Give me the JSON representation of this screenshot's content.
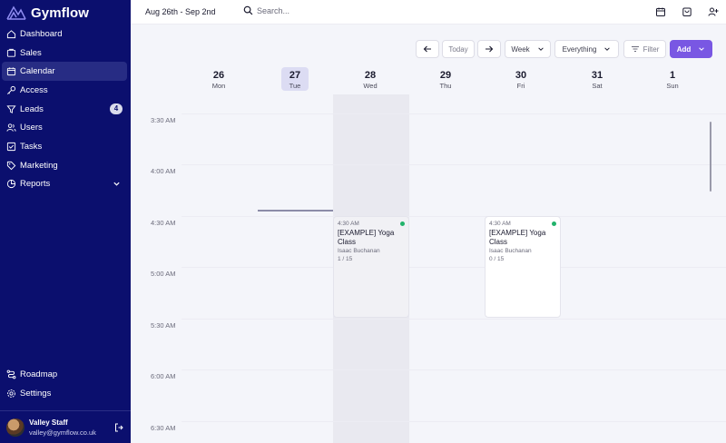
{
  "brand": {
    "name": "Gymflow"
  },
  "nav": {
    "items": [
      {
        "label": "Dashboard",
        "icon": "home-icon"
      },
      {
        "label": "Sales",
        "icon": "sales-icon"
      },
      {
        "label": "Calendar",
        "icon": "calendar-icon",
        "active": true
      },
      {
        "label": "Access",
        "icon": "key-icon"
      },
      {
        "label": "Leads",
        "icon": "filter-icon",
        "badge": "4"
      },
      {
        "label": "Users",
        "icon": "users-icon"
      },
      {
        "label": "Tasks",
        "icon": "tasks-icon"
      },
      {
        "label": "Marketing",
        "icon": "tag-icon"
      },
      {
        "label": "Reports",
        "icon": "reports-icon",
        "expandable": true
      }
    ],
    "bottom": [
      {
        "label": "Roadmap",
        "icon": "roadmap-icon"
      },
      {
        "label": "Settings",
        "icon": "gear-icon"
      }
    ]
  },
  "user": {
    "name": "Valley Staff",
    "email": "valley@gymflow.co.uk"
  },
  "topbar": {
    "date_range": "Aug 26th - Sep 2nd",
    "search_placeholder": "Search..."
  },
  "toolbar": {
    "today_label": "Today",
    "view_label": "Week",
    "scope_label": "Everything",
    "filter_label": "Filter",
    "add_label": "Add"
  },
  "days": [
    {
      "num": "26",
      "name": "Mon"
    },
    {
      "num": "27",
      "name": "Tue",
      "today": true
    },
    {
      "num": "28",
      "name": "Wed"
    },
    {
      "num": "29",
      "name": "Thu"
    },
    {
      "num": "30",
      "name": "Fri"
    },
    {
      "num": "31",
      "name": "Sat"
    },
    {
      "num": "1",
      "name": "Sun"
    }
  ],
  "times": [
    "3:30 AM",
    "4:00 AM",
    "4:30 AM",
    "5:00 AM",
    "5:30 AM",
    "6:00 AM",
    "6:30 AM"
  ],
  "events": [
    {
      "day": "Wed",
      "time": "4:30 AM",
      "title": "[EXAMPLE] Yoga Class",
      "instructor": "Isaac Buchanan",
      "capacity": "1 / 15",
      "status_color": "#22b36b",
      "faded": true
    },
    {
      "day": "Fri",
      "time": "4:30 AM",
      "title": "[EXAMPLE] Yoga Class",
      "instructor": "Isaac Buchanan",
      "capacity": "0 / 15",
      "status_color": "#22b36b",
      "faded": false
    }
  ],
  "colors": {
    "sidebar": "#0b0f6e",
    "accent": "#7957e3",
    "today": "#dcdcf3"
  }
}
